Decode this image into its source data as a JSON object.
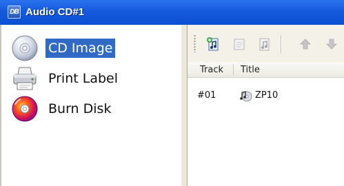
{
  "window": {
    "title": "Audio CD#1",
    "app_icon_text": "DB"
  },
  "sidebar": {
    "items": [
      {
        "label": "CD Image",
        "icon": "cd-disc-icon",
        "selected": true
      },
      {
        "label": "Print Label",
        "icon": "printer-icon",
        "selected": false
      },
      {
        "label": "Burn Disk",
        "icon": "burn-disc-icon",
        "selected": false
      }
    ]
  },
  "toolbar": {
    "buttons": [
      {
        "icon": "add-audio-icon",
        "enabled": true
      },
      {
        "icon": "edit-label-icon",
        "enabled": false
      },
      {
        "icon": "remove-audio-icon",
        "enabled": false
      },
      {
        "icon": "move-up-icon",
        "enabled": false
      },
      {
        "icon": "move-down-icon",
        "enabled": false
      }
    ]
  },
  "tracklist": {
    "columns": [
      "Track",
      "Title"
    ],
    "rows": [
      {
        "track": "#01",
        "title": "ZP10",
        "icon": "audio-file-icon"
      }
    ]
  },
  "colors": {
    "titlebar": "#0b4fd2",
    "selection": "#316ac5"
  }
}
